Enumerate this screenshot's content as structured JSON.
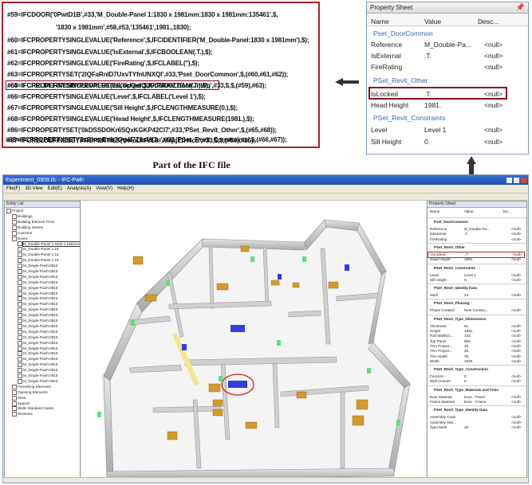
{
  "ifc_code": {
    "lines": [
      "#59=IFCDOOR('0PwtD1B',#33,'M_Double-Panel 1:1830 x 1981mm:1830 x 1981mm:135461',$,",
      "'1830 x 1981mm',#58,#53,'135461',1981.,1830);",
      "#60=IFCPROPERTYSINGLEVALUE('Reference',$,IFCIDENTIFIER('M_Double-Panel:1830 x 1981mm'),$);",
      "#61=IFCPROPERTYSINGLEVALUE('IsExternal',$,IFCBOOLEAN(.T.),$);",
      "#62=IFCPROPERTYSINGLEVALUE('FireRating',$,IFCLABEL(''),$);",
      "#63=IFCPROPERTYSET('2lQFaRnlD7UxvTYfnUNXQl',#33,'Pset_DoorCommon',$,(#60,#61,#62));",
      "#64=IFCRELDEFINESBYPROPERTIES('0pQmQ1UrP4U9Z7fcoVJnWq',#33,$,$,(#59),#63);",
      "#65=IFCPROPERTYSINGLEVALUE('IsLocked',$,IFCBOOLEAN(.T.),$);",
      "#66=IFCPROPERTYSINGLEVALUE('Level',$,IFCLABEL('Level 1'),$);",
      "#67=IFCPROPERTYSINGLEVALUE('Sill Height',$,IFCLENGTHMEASURE(0.),$);",
      "#68=IFCPROPERTYSINGLEVALUE('Head Height',$,IFCLENGTHMEASURE(1981.),$);",
      "#86=IFCPROPERTYSET('0kDSSDOKr6SQxKGKP42Cl7',#33,'PSet_Revit_Other',$,(#65,#68));",
      "#87=IFCRELDEFINESBYPROPERTIES('0oiuLkFcL8_AMjrj11H4cL',#33,$,$,(#59),#86);",
      "#88=IFCPROPERTYSET('2xBhcoEnb3Og4f7Z0sMf3u',#33,'PSet_Revit_Constraints',$,(#66,#67));"
    ]
  },
  "caption": "Part of the IFC file",
  "property_sheet": {
    "title": "Property Sheet",
    "pin_icon": "pin-icon",
    "columns": [
      "Name",
      "Value",
      "Desc..."
    ],
    "groups": {
      "door_common": "Pset_DoorCommon",
      "revit_other": "PSet_Revit_Other",
      "revit_constraints": "PSet_Revit_Constraints"
    },
    "rows": {
      "reference": {
        "name": "Reference",
        "value": "M_Double-Pa...",
        "desc": "<null>"
      },
      "is_external": {
        "name": "IsExternal",
        "value": ".T.",
        "desc": "<null>"
      },
      "fire_rating": {
        "name": "FireRating",
        "value": "",
        "desc": "<null>"
      },
      "is_locked": {
        "name": "IsLocked",
        "value": ".T.",
        "desc": "<null>"
      },
      "head_height": {
        "name": "Head Height",
        "value": "1981.",
        "desc": "<null>"
      },
      "level": {
        "name": "Level",
        "value": "Level 1",
        "desc": "<null>"
      },
      "sill_height": {
        "name": "Sill Height",
        "value": "0.",
        "desc": "<null>"
      }
    }
  },
  "app": {
    "title": "Experiment_0909.ifc - IFC-Path",
    "menu": [
      "File(F)",
      "3D View",
      "Edit(E)",
      "Analysis(A)",
      "View(V)",
      "Help(H)"
    ],
    "entity_list": {
      "title": "Entity List",
      "items": [
        "Project",
        "Buildings",
        "Building Element Proxi",
        "Building Stories",
        "Columns",
        "Doors",
        "M_Double-Panel 1:1830 x 1981mm:1830 x 1981mm:135510",
        "M_Double-Panel 1:18",
        "M_Double-Panel 1:18",
        "M_Double-Panel 1:18",
        "M_Single-Flush:0915",
        "M_Single-Flush:0915",
        "M_Single-Flush:0915",
        "M_Single-Flush:0915",
        "M_Single-Flush:0915",
        "M_Single-Flush:0915",
        "M_Single-Flush:0915",
        "M_Single-Flush:0915",
        "M_Single-Flush:0915",
        "M_Single-Flush:0915",
        "M_Single-Flush:0915",
        "M_Single-Flush:0915",
        "M_Single-Flush:0915",
        "M_Single-Flush:0915",
        "M_Single-Flush:0915",
        "M_Single-Flush:0915",
        "M_Single-Flush:0915",
        "M_Single-Flush:0915",
        "M_Single-Flush:0915",
        "M_Single-Flush:0915",
        "M_Single-Flush:0915",
        "M_Single-Flush:0915",
        "Furnishing Elements",
        "Opening Elements",
        "Sites",
        "Spaces",
        "Walls Standard Cases",
        "Windows"
      ]
    },
    "small_sheet": {
      "title": "Property Sheet",
      "columns": [
        "Name",
        "Value",
        "De..."
      ],
      "groups": [
        "Pset_DoorCommon",
        "PSet_Revit_Other",
        "PSet_Revit_Constraints",
        "PSet_Revit_Identity Data",
        "PSet_Revit_Phasing",
        "PSet_Revit_Type_Dimensions",
        "PSet_Revit_Type_Construction",
        "PSet_Revit_Type_Materials and Finis",
        "PSet_Revit_Type_Identity Data"
      ],
      "rows": {
        "reference": [
          "Reference",
          "M_Double-Pa...",
          "<null>"
        ],
        "is_external": [
          "IsExternal",
          ".T.",
          "<null>"
        ],
        "fire_rating": [
          "FireRating",
          "",
          "<null>"
        ],
        "is_locked": [
          "IsLocked",
          ".T.",
          "<null>"
        ],
        "head_height": [
          "Head Height",
          "1981.",
          "<null>"
        ],
        "level": [
          "Level",
          "Level 1",
          "<null>"
        ],
        "sill_height": [
          "Sill Height",
          "0.",
          "<null>"
        ],
        "mark": [
          "Mark",
          "24.",
          "<null>"
        ],
        "phase_created": [
          "Phase Created",
          "New Constru...",
          "<null>"
        ],
        "thickness": [
          "Thickness",
          "51.",
          "<null>"
        ],
        "height": [
          "Height",
          "1981.",
          "<null>"
        ],
        "rail_width_c": [
          "Rail Width(C...",
          "102.",
          "<null>"
        ],
        "top_panel": [
          "Top Panel",
          "965.",
          "<null>"
        ],
        "trim_project_1": [
          "Trim Project...",
          "25.",
          "<null>"
        ],
        "trim_project_2": [
          "Trim Project...",
          "25.",
          "<null>"
        ],
        "trim_width": [
          "Trim Width",
          "76.",
          "<null>"
        ],
        "width": [
          "Width",
          "1830.",
          "<null>"
        ],
        "function": [
          "Function",
          "0",
          "<null>"
        ],
        "wall_closure": [
          "Wall Closure",
          "0",
          "<null>"
        ],
        "door_material": [
          "Door Material",
          "Door - Panel",
          "<null>"
        ],
        "frame_material": [
          "Frame Material",
          "Door - Frame",
          "<null>"
        ],
        "assembly_code": [
          "Assembly Code",
          "",
          "<null>"
        ],
        "assembly_des": [
          "Assembly Des...",
          "",
          "<null>"
        ],
        "type_mark": [
          "Type Mark",
          "33",
          "<null>"
        ]
      }
    }
  },
  "colors": {
    "highlight_red": "#b0202a",
    "group_blue": "#3a66b5",
    "wall_gray": "#c9c9c9",
    "door_blue": "#2f3fe0",
    "furniture_orange": "#d49a2a",
    "window_green": "#5ee07a",
    "title_blue": "#2a5cc4"
  }
}
